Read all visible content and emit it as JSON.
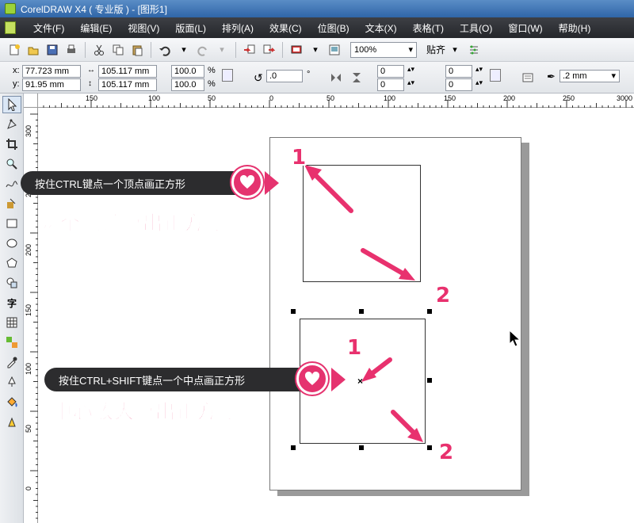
{
  "window": {
    "title": "CorelDRAW X4 ( 专业版 ) - [图形1]"
  },
  "menu": {
    "items": [
      "文件(F)",
      "编辑(E)",
      "视图(V)",
      "版面(L)",
      "排列(A)",
      "效果(C)",
      "位图(B)",
      "文本(X)",
      "表格(T)",
      "工具(O)",
      "窗口(W)",
      "帮助(H)"
    ]
  },
  "toolbar": {
    "zoom_value": "100%",
    "snap_label": "贴齐"
  },
  "properties": {
    "x_label": "x:",
    "x_value": "77.723 mm",
    "y_label": "y:",
    "y_value": "91.95 mm",
    "width_value": "105.117 mm",
    "height_value": "105.117 mm",
    "scale_x": "100.0",
    "scale_y": "100.0",
    "percent": "%",
    "rotation": ".0",
    "degree": "°",
    "corner_tl": "0",
    "corner_bl": "0",
    "corner_tr": "0",
    "corner_br": "0",
    "outline_width": ".2 mm"
  },
  "ruler": {
    "top_ticks": [
      "150",
      "100",
      "50",
      "0",
      "50",
      "100",
      "150",
      "200",
      "250",
      "3000"
    ],
    "left_ticks": [
      "300",
      "250",
      "200",
      "150",
      "100",
      "50",
      "0"
    ]
  },
  "annotations": {
    "callout1_text": "按住CTRL键点一个顶点画正方形",
    "caption1": "两个点顶拉出正方形",
    "callout2_text": "按住CTRL+SHIFT键点一个中点画正方形",
    "caption2": "中心放大拉出正方形",
    "num1a": "1",
    "num2a": "2",
    "num1b": "1",
    "num2b": "2"
  },
  "colors": {
    "accent": "#e8316e",
    "menubar": "#2f3136",
    "callout_bg": "#2c2c2e"
  }
}
